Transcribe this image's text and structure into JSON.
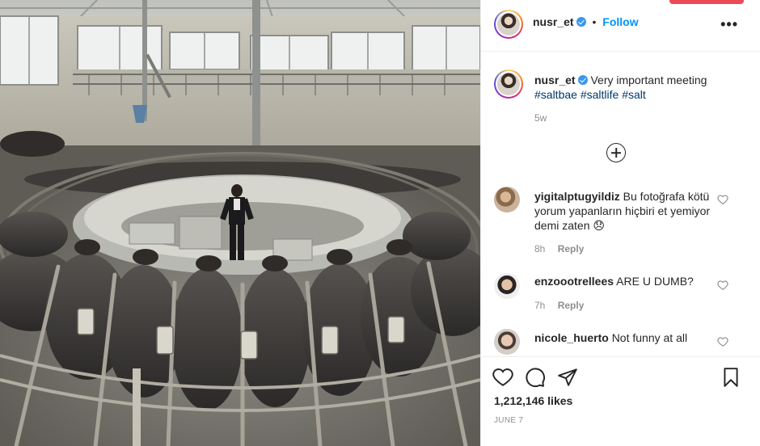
{
  "post": {
    "author": "nusr_et",
    "verified": true,
    "follow_label": "Follow",
    "separator": "•",
    "more_label": "•••",
    "caption": {
      "text": "Very important meeting",
      "hashtags": [
        "#saltbae",
        "#saltlife",
        "#salt"
      ]
    },
    "caption_time": "5w",
    "likes": "1,212,146 likes",
    "date": "JUNE 7"
  },
  "comments": [
    {
      "username": "yigitalptugyildiz",
      "text": "Bu fotoğrafa kötü yorum yapanların hiçbiri et yemiyor demi zaten 😞",
      "time": "8h",
      "reply_label": "Reply"
    },
    {
      "username": "enzoootrellees",
      "text": "ARE U DUMB?",
      "time": "7h",
      "reply_label": "Reply"
    },
    {
      "username": "nicole_huerto",
      "text": "Not funny at all",
      "time": "",
      "reply_label": ""
    }
  ],
  "icons": {
    "like": "heart-icon",
    "comment": "comment-icon",
    "share": "share-icon",
    "save": "bookmark-icon",
    "more_comments": "plus-circle-icon",
    "options": "more-options-icon"
  },
  "colors": {
    "accent_blue": "#0095f6",
    "hashtag": "#00376b",
    "meta_gray": "#8e8e8e",
    "text": "#262626",
    "notification_red": "#ed4956"
  }
}
